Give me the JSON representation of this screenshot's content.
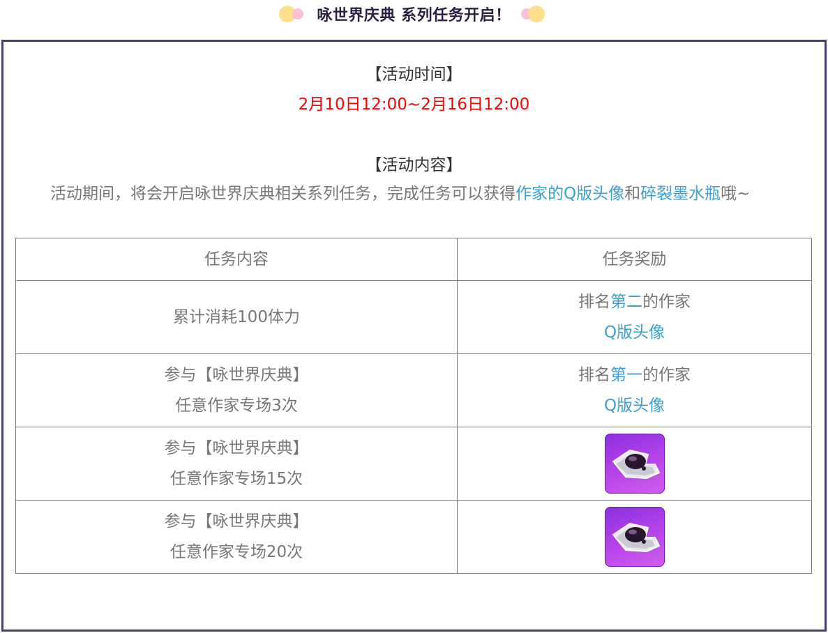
{
  "header": {
    "title": "咏世界庆典 系列任务开启！"
  },
  "activity_time": {
    "label": "【活动时间】",
    "value": "2月10日12:00~2月16日12:00"
  },
  "activity_content": {
    "label": "【活动内容】",
    "desc_prefix": "活动期间，将会开启咏世界庆典相关系列任务，完成任务可以获得",
    "highlight_1": "作家的Q版头像",
    "connector": "和",
    "highlight_2": "碎裂墨水瓶",
    "suffix": "哦~"
  },
  "table": {
    "headers": [
      "任务内容",
      "任务奖励"
    ],
    "rows": [
      {
        "task_lines": [
          "累计消耗100体力"
        ],
        "reward_prefix": "排名",
        "reward_rank": "第二",
        "reward_suffix": "的作家",
        "reward_item": "Q版头像"
      },
      {
        "task_lines": [
          "参与【咏世界庆典】",
          "任意作家专场3次"
        ],
        "reward_prefix": "排名",
        "reward_rank": "第一",
        "reward_suffix": "的作家",
        "reward_item": "Q版头像"
      },
      {
        "task_lines": [
          "参与【咏世界庆典】",
          "任意作家专场15次"
        ],
        "reward_icon": "broken-ink-bottle-icon"
      },
      {
        "task_lines": [
          "参与【咏世界庆典】",
          "任意作家专场20次"
        ],
        "reward_icon": "broken-ink-bottle-icon"
      }
    ]
  },
  "colors": {
    "frame": "#4a3f74",
    "time_red": "#ff0000",
    "highlight_blue": "#3c9fd0",
    "icon_purple": "#b845e8"
  }
}
